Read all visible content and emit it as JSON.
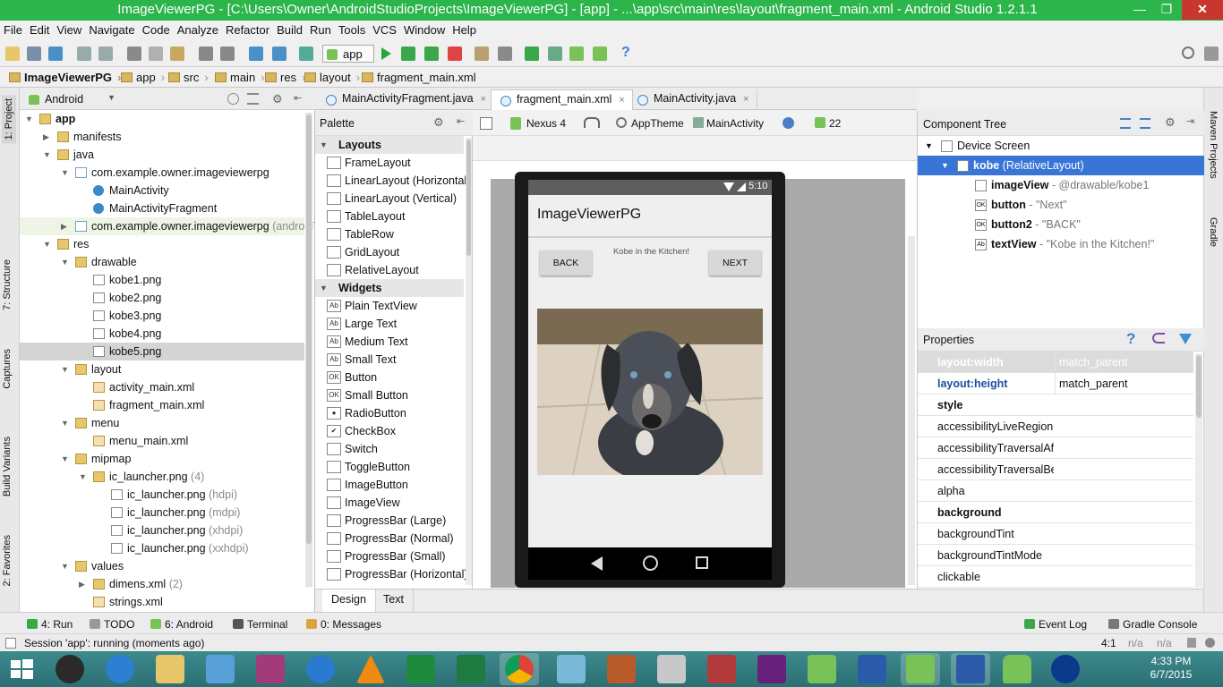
{
  "window": {
    "title": "ImageViewerPG - [C:\\Users\\Owner\\AndroidStudioProjects\\ImageViewerPG] - [app] - ...\\app\\src\\main\\res\\layout\\fragment_main.xml - Android Studio 1.2.1.1",
    "close": "✕",
    "minimize": "—",
    "restore": "❐"
  },
  "menu": [
    "File",
    "Edit",
    "View",
    "Navigate",
    "Code",
    "Analyze",
    "Refactor",
    "Build",
    "Run",
    "Tools",
    "VCS",
    "Window",
    "Help"
  ],
  "toolbar": {
    "run_config": "app",
    "help": "?"
  },
  "breadcrumbs": [
    "ImageViewerPG",
    "app",
    "src",
    "main",
    "res",
    "layout",
    "fragment_main.xml"
  ],
  "left_strip": {
    "project": "1: Project",
    "structure": "7: Structure",
    "captures": "Captures",
    "build_variants": "Build Variants",
    "favorites": "2: Favorites"
  },
  "right_strip": {
    "maven": "Maven Projects",
    "gradle": "Gradle"
  },
  "project": {
    "view": "Android",
    "tree": [
      {
        "label": "app",
        "bold": true
      },
      {
        "label": "manifests"
      },
      {
        "label": "java"
      },
      {
        "label": "com.example.owner.imageviewerpg"
      },
      {
        "label": "MainActivity"
      },
      {
        "label": "MainActivityFragment"
      },
      {
        "label": "com.example.owner.imageviewerpg",
        "suffix": " (androidTest)"
      },
      {
        "label": "res"
      },
      {
        "label": "drawable"
      },
      {
        "label": "kobe1.png"
      },
      {
        "label": "kobe2.png"
      },
      {
        "label": "kobe3.png"
      },
      {
        "label": "kobe4.png"
      },
      {
        "label": "kobe5.png"
      },
      {
        "label": "layout"
      },
      {
        "label": "activity_main.xml"
      },
      {
        "label": "fragment_main.xml"
      },
      {
        "label": "menu"
      },
      {
        "label": "menu_main.xml"
      },
      {
        "label": "mipmap"
      },
      {
        "label": "ic_launcher.png",
        "suffix": " (4)"
      },
      {
        "label": "ic_launcher.png",
        "suffix": " (hdpi)"
      },
      {
        "label": "ic_launcher.png",
        "suffix": " (mdpi)"
      },
      {
        "label": "ic_launcher.png",
        "suffix": " (xhdpi)"
      },
      {
        "label": "ic_launcher.png",
        "suffix": " (xxhdpi)"
      },
      {
        "label": "values"
      },
      {
        "label": "dimens.xml",
        "suffix": " (2)"
      },
      {
        "label": "strings.xml"
      }
    ]
  },
  "editor_tabs": [
    {
      "label": "MainActivityFragment.java",
      "close": "×"
    },
    {
      "label": "fragment_main.xml",
      "close": "×"
    },
    {
      "label": "MainActivity.java",
      "close": "×"
    }
  ],
  "palette": {
    "title": "Palette",
    "sections": [
      {
        "name": "Layouts",
        "items": [
          {
            "icon": "",
            "label": "FrameLayout"
          },
          {
            "icon": "",
            "label": "LinearLayout (Horizontal)"
          },
          {
            "icon": "",
            "label": "LinearLayout (Vertical)"
          },
          {
            "icon": "",
            "label": "TableLayout"
          },
          {
            "icon": "",
            "label": "TableRow"
          },
          {
            "icon": "",
            "label": "GridLayout"
          },
          {
            "icon": "",
            "label": "RelativeLayout"
          }
        ]
      },
      {
        "name": "Widgets",
        "items": [
          {
            "icon": "Ab",
            "label": "Plain TextView"
          },
          {
            "icon": "Ab",
            "label": "Large Text"
          },
          {
            "icon": "Ab",
            "label": "Medium Text"
          },
          {
            "icon": "Ab",
            "label": "Small Text"
          },
          {
            "icon": "OK",
            "label": "Button"
          },
          {
            "icon": "OK",
            "label": "Small Button"
          },
          {
            "icon": "●",
            "label": "RadioButton"
          },
          {
            "icon": "✔",
            "label": "CheckBox"
          },
          {
            "icon": "",
            "label": "Switch"
          },
          {
            "icon": "",
            "label": "ToggleButton"
          },
          {
            "icon": "",
            "label": "ImageButton"
          },
          {
            "icon": "",
            "label": "ImageView"
          },
          {
            "icon": "",
            "label": "ProgressBar (Large)"
          },
          {
            "icon": "",
            "label": "ProgressBar (Normal)"
          },
          {
            "icon": "",
            "label": "ProgressBar (Small)"
          },
          {
            "icon": "",
            "label": "ProgressBar (Horizontal)"
          }
        ]
      }
    ]
  },
  "designer": {
    "device": "Nexus 4",
    "theme": "AppTheme",
    "activity": "MainActivity",
    "api": "22",
    "phone": {
      "time": "5:10",
      "app_title": "ImageViewerPG",
      "back_button": "BACK",
      "next_button": "NEXT",
      "caption": "Kobe in the Kitchen!"
    }
  },
  "component_tree": {
    "title": "Component Tree",
    "rows": [
      {
        "name": "Device Screen",
        "detail": ""
      },
      {
        "name": "kobe",
        "detail": " (RelativeLayout)"
      },
      {
        "name": "imageView",
        "detail": " - @drawable/kobe1"
      },
      {
        "name": "button",
        "detail": " - \"Next\""
      },
      {
        "name": "button2",
        "detail": " - \"BACK\""
      },
      {
        "name": "textView",
        "detail": " - \"Kobe in the Kitchen!\""
      }
    ],
    "icons": [
      "",
      "",
      "",
      "OK",
      "OK",
      "Ab"
    ]
  },
  "properties": {
    "title": "Properties",
    "help": "?",
    "rows": [
      {
        "name": "layout:width",
        "value": "match_parent"
      },
      {
        "name": "layout:height",
        "value": "match_parent"
      },
      {
        "name": "style",
        "value": ""
      },
      {
        "name": "accessibilityLiveRegion",
        "value": ""
      },
      {
        "name": "accessibilityTraversalAfter",
        "value": ""
      },
      {
        "name": "accessibilityTraversalBefore",
        "value": ""
      },
      {
        "name": "alpha",
        "value": ""
      },
      {
        "name": "background",
        "value": ""
      },
      {
        "name": "backgroundTint",
        "value": ""
      },
      {
        "name": "backgroundTintMode",
        "value": ""
      },
      {
        "name": "clickable",
        "value": ""
      }
    ]
  },
  "bottom_tabs": [
    "Design",
    "Text"
  ],
  "tool_windows": {
    "run": "4: Run",
    "todo": "TODO",
    "android": "6: Android",
    "terminal": "Terminal",
    "messages": "0: Messages",
    "event_log": "Event Log",
    "gradle_console": "Gradle Console"
  },
  "status": {
    "message": "Session 'app': running (moments ago)",
    "position": "4:1",
    "na1": "n/a",
    "na2": "n/a"
  },
  "taskbar": {
    "time": "4:33 PM",
    "date": "6/7/2015"
  },
  "colors": {
    "title_bar": "#2bb54b",
    "selection": "#3875d7",
    "close": "#c7372f"
  }
}
